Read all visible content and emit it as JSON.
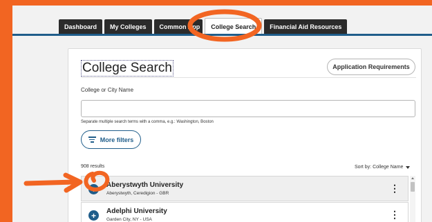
{
  "tabs": [
    {
      "label": "Dashboard",
      "active": false
    },
    {
      "label": "My Colleges",
      "active": false
    },
    {
      "label": "Common App",
      "active": false
    },
    {
      "label": "College Search",
      "active": true
    },
    {
      "label": "Financial Aid Resources",
      "active": false
    }
  ],
  "page": {
    "title": "College Search",
    "app_requirements_label": "Application Requirements"
  },
  "search": {
    "label": "College or City Name",
    "value": "",
    "placeholder": "",
    "hint": "Separate multiple search terms with a comma, e.g.: Washington, Boston"
  },
  "filters": {
    "more_label": "More filters",
    "icon": "filter-lines-icon"
  },
  "results": {
    "count_text": "908 results",
    "sort_text": "Sort by: College Name",
    "items": [
      {
        "name": "Aberystwyth University",
        "location": "Aberystwyth, Ceredigion - GBR"
      },
      {
        "name": "Adelphi University",
        "location": "Garden City, NY - USA"
      }
    ]
  },
  "colors": {
    "accent": "#1f5d8a",
    "annotation": "#f26522",
    "tab_dark": "#2b2b2b"
  }
}
